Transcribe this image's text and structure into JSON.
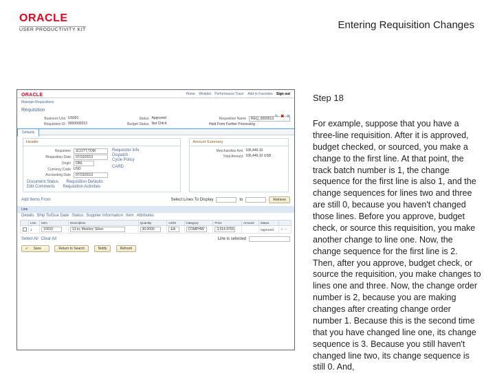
{
  "header": {
    "brand": "ORACLE",
    "product_line": "USER PRODUCTIVITY KIT",
    "page_title": "Entering Requisition Changes"
  },
  "tutorial": {
    "step_label": "Step 18",
    "body": "For example, suppose that you have a three-line requisition. After it is approved, budget checked, or sourced, you make a change to the first line. At that point, the track batch number is 1, the change sequence for the first line is also 1, and the change sequences for lines two and three are still 0, because you haven't changed those lines. Before you approve, budget check, or source this requisition, you make another change to line one. Now, the change sequence for the first line is 2. Then, after you approve, budget check, or source the requisition, you make changes to lines one and three. Now, the change order number is 2, because you are making changes after creating change order number 1. Because this is the second time that you have changed line one, its change sequence is 3. Because you still haven't changed line two, its change sequence is still 0. And,"
  },
  "app": {
    "brand": "ORACLE",
    "nav_items": [
      "Home",
      "Worklist",
      "Performance Trace",
      "Add to Favorites",
      "Sign out"
    ],
    "nav_selected_index": 4,
    "breadcrumb": "Maintain Requisitions",
    "section_title": "Requisition",
    "actions": {
      "edit": "✎",
      "cancel": "✖",
      "refresh": "⟳"
    },
    "summary": {
      "left": [
        {
          "label": "Business Unit",
          "value": "US001"
        },
        {
          "label": "Requisition ID",
          "value": "0000000013"
        },
        {
          "label": "Requisition Name",
          "value": "REQ_0000013"
        }
      ],
      "right": [
        {
          "label": "Status",
          "value": "Approved"
        },
        {
          "label": "Budget Status",
          "value": "Not Chk'd"
        },
        {
          "label": "Hold From Further Processing",
          "value": ""
        }
      ]
    },
    "tabs": [
      "Defaults"
    ],
    "active_tab": 0,
    "header_block": {
      "title": "Header",
      "left": [
        {
          "label": "Requester",
          "value": "SCOTT,TOM"
        },
        {
          "label": "Requisition Date",
          "value": "07/23/2013"
        },
        {
          "label": "Origin",
          "value": "ONL"
        },
        {
          "label": "Currency Code",
          "value": "USD"
        },
        {
          "label": "Accounting Date",
          "value": "07/23/2013"
        }
      ],
      "right_links": [
        "Requester Info",
        "Dispatch",
        "Cycle Policy"
      ],
      "card_link": "CARD"
    },
    "amount_summary": {
      "title": "Amount Summary",
      "rows": [
        {
          "label": "Merchandise Amt",
          "value": "105,449.10"
        },
        {
          "label": "Total Amount",
          "value": "105,449.10",
          "currency": "USD"
        }
      ],
      "doc_links": [
        "Document Status",
        "Requisition Defaults",
        "Edit Comments",
        "Requisition Activities"
      ]
    },
    "line_toolbar": {
      "add_link": "Add Items From",
      "right_label": "Select Lines To Display",
      "button": "Retrieve"
    },
    "lines": {
      "title": "Line",
      "view_tabs": [
        "Details",
        "Ship To/Due Date",
        "Status",
        "Supplier Information",
        "Item",
        "Attributes"
      ],
      "columns": [
        "",
        "Line",
        "Item",
        "Description",
        "Quantity",
        "UOM",
        "Category",
        "Price",
        "Amount",
        "Status",
        ""
      ],
      "rows": [
        {
          "sel": false,
          "line": "1",
          "item": "10010",
          "desc": "13 in; Monitor; Silver",
          "qty": "30.0000",
          "uom": "EA",
          "category": "COMPHW",
          "price": "3,514.9700",
          "amount": "",
          "status": "Approved"
        }
      ]
    },
    "footer": {
      "select_all": "Select All",
      "clear_all": "Clear All",
      "line_selector_label": "Line is selected",
      "buttons": [
        "Save",
        "Return to Search",
        "Notify",
        "Refresh"
      ]
    }
  }
}
